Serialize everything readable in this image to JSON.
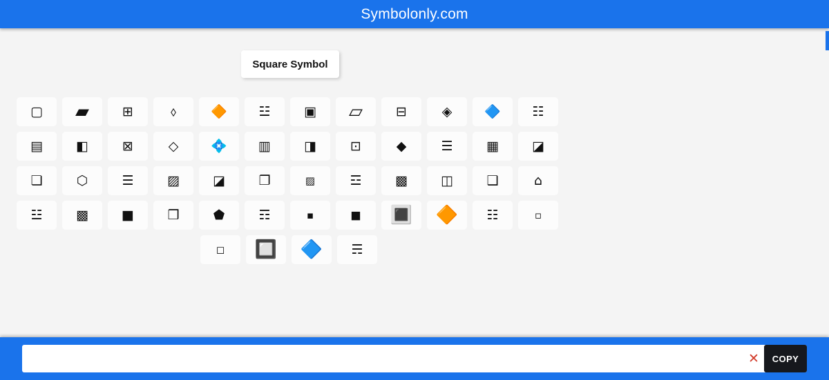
{
  "header": {
    "title": "Symbolonly.com",
    "background_color": "#1a73eb",
    "text_color": "#ffffff"
  },
  "category_label": {
    "text": "Square Symbol"
  },
  "symbols": {
    "rows": [
      [
        {
          "glyph": "▢",
          "name": "white-square-rounded-corners",
          "size": "md"
        },
        {
          "glyph": "▰",
          "name": "black-parallelogram",
          "size": "lg"
        },
        {
          "glyph": "⊞",
          "name": "squared-plus",
          "size": "md"
        },
        {
          "glyph": "⬨",
          "name": "white-lozenge",
          "size": "md"
        },
        {
          "glyph": "🔶",
          "name": "large-orange-diamond",
          "size": "md"
        },
        {
          "glyph": "☳",
          "name": "trigram-thunder",
          "size": "md"
        },
        {
          "glyph": "▣",
          "name": "white-square-black-small-square",
          "size": "md"
        },
        {
          "glyph": "▱",
          "name": "white-parallelogram",
          "size": "lg"
        },
        {
          "glyph": "⊟",
          "name": "squared-minus",
          "size": "md"
        },
        {
          "glyph": "◈",
          "name": "white-diamond-black-small-diamond",
          "size": "md"
        },
        {
          "glyph": "🔷",
          "name": "large-blue-diamond",
          "size": "md"
        },
        {
          "glyph": "☷",
          "name": "trigram-earth",
          "size": "md"
        }
      ],
      [
        {
          "glyph": "▤",
          "name": "square-horizontal-fill",
          "size": "md"
        },
        {
          "glyph": "◧",
          "name": "square-left-half-black",
          "size": "md"
        },
        {
          "glyph": "⊠",
          "name": "squared-times",
          "size": "md"
        },
        {
          "glyph": "◇",
          "name": "white-diamond",
          "size": "md"
        },
        {
          "glyph": "💠",
          "name": "diamond-shape-with-dot-inside",
          "size": "md"
        },
        {
          "glyph": "▥",
          "name": "square-vertical-fill",
          "size": "md"
        },
        {
          "glyph": "◨",
          "name": "square-right-half-black",
          "size": "md"
        },
        {
          "glyph": "⊡",
          "name": "squared-dot-operator",
          "size": "md"
        },
        {
          "glyph": "◆",
          "name": "black-diamond",
          "size": "md"
        },
        {
          "glyph": "☰",
          "name": "trigram-heaven-two-bar",
          "size": "md"
        },
        {
          "glyph": "▦",
          "name": "square-fill-grid",
          "size": "md"
        },
        {
          "glyph": "◪",
          "name": "square-lower-right-diagonal-half-black",
          "size": "md"
        }
      ],
      [
        {
          "glyph": "❏",
          "name": "lower-right-shadowed-white-square",
          "size": "md"
        },
        {
          "glyph": "⬡",
          "name": "white-hexagon",
          "size": "md"
        },
        {
          "glyph": "☰",
          "name": "trigram-heaven",
          "size": "md"
        },
        {
          "glyph": "▨",
          "name": "square-upper-left-to-lower-right-fill",
          "size": "md"
        },
        {
          "glyph": "◪",
          "name": "square-diagonal-half-black",
          "size": "md"
        },
        {
          "glyph": "❐",
          "name": "upper-right-shadowed-white-square",
          "size": "md"
        },
        {
          "glyph": "▨",
          "name": "rounded-hatched-square-small",
          "size": "sm"
        },
        {
          "glyph": "☲",
          "name": "trigram-fire",
          "size": "md"
        },
        {
          "glyph": "▩",
          "name": "square-crosshatch-fill",
          "size": "md"
        },
        {
          "glyph": "◫",
          "name": "square-vertical-bisecting-line",
          "size": "md"
        },
        {
          "glyph": "❑",
          "name": "lower-right-shadowed-square",
          "size": "md"
        },
        {
          "glyph": "⌂",
          "name": "house-pentagon-outline",
          "size": "md"
        }
      ],
      [
        {
          "glyph": "☳",
          "name": "trigram-thunder-alt",
          "size": "md"
        },
        {
          "glyph": "▩",
          "name": "square-checkerboard-fill",
          "size": "md"
        },
        {
          "glyph": "■",
          "name": "black-square",
          "size": "md"
        },
        {
          "glyph": "❒",
          "name": "upper-right-shadowed-white-square-alt",
          "size": "md"
        },
        {
          "glyph": "⬟",
          "name": "black-house-pentagon",
          "size": "md"
        },
        {
          "glyph": "☶",
          "name": "trigram-mountain",
          "size": "md"
        },
        {
          "glyph": "▪",
          "name": "black-small-square",
          "size": "sm"
        },
        {
          "glyph": "◼",
          "name": "black-medium-square",
          "size": "md"
        },
        {
          "glyph": "🔳",
          "name": "white-square-button",
          "size": "lg"
        },
        {
          "glyph": "🔶",
          "name": "large-orange-diamond-alt",
          "size": "lg"
        },
        {
          "glyph": "☷",
          "name": "trigram-earth-alt",
          "size": "md"
        },
        {
          "glyph": "▫",
          "name": "white-small-square",
          "size": "sm"
        }
      ],
      [
        {
          "glyph": "◻",
          "name": "white-medium-square",
          "size": "sm"
        },
        {
          "glyph": "🔲",
          "name": "black-square-button",
          "size": "lg"
        },
        {
          "glyph": "🔷",
          "name": "large-blue-diamond-alt",
          "size": "lg"
        },
        {
          "glyph": "☴",
          "name": "trigram-wind",
          "size": "md"
        }
      ]
    ]
  },
  "bottom_bar": {
    "input_value": "",
    "input_placeholder": "",
    "clear_label": "✕",
    "copy_label": "COPY",
    "background_color": "#1a73eb",
    "copy_button_color": "#16181d",
    "clear_icon_color": "#d23b2a"
  }
}
